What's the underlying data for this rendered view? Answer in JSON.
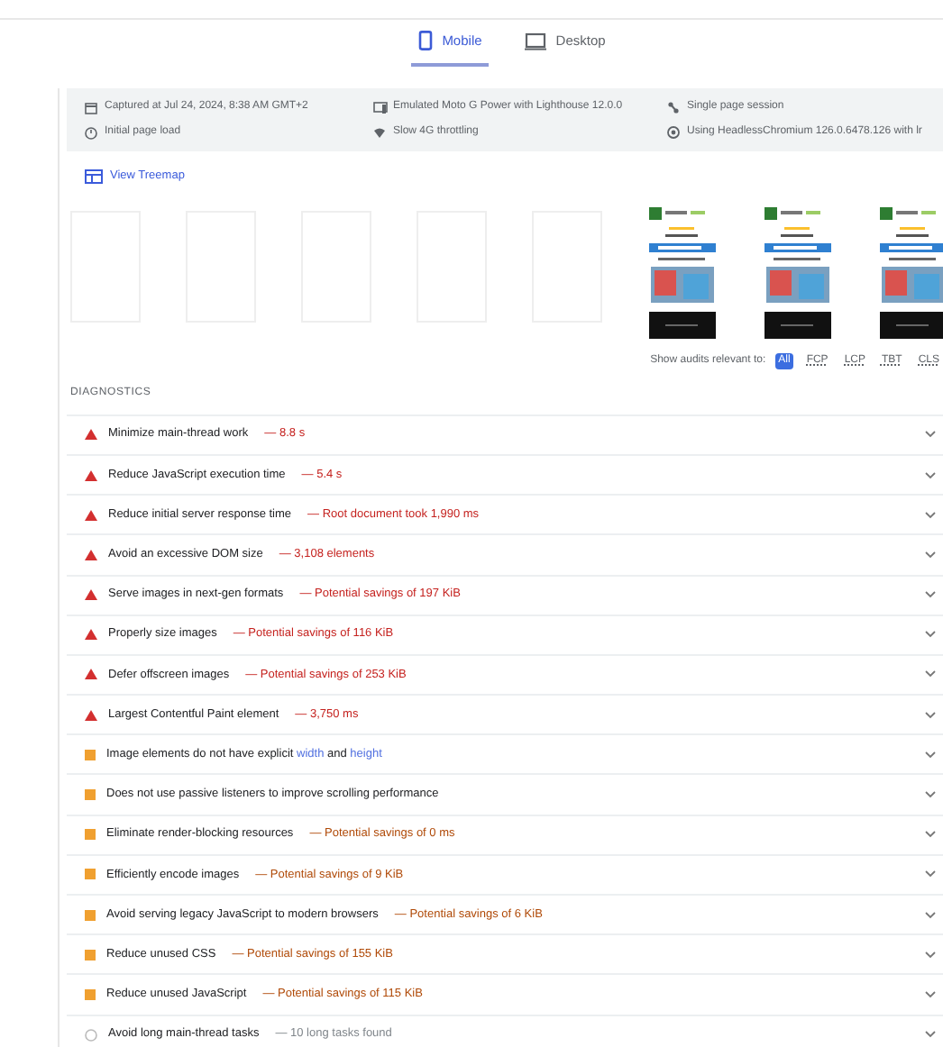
{
  "tabs": [
    {
      "label": "Mobile",
      "kind": "mobile",
      "selected": true
    },
    {
      "label": "Desktop",
      "kind": "desktop",
      "selected": false
    }
  ],
  "meta": [
    {
      "kind": "calendar",
      "text": "Captured at Jul 24, 2024, 8:38 AM GMT+2"
    },
    {
      "kind": "device",
      "text": "Emulated Moto G Power with Lighthouse 12.0.0"
    },
    {
      "kind": "session",
      "text": "Single page session"
    },
    {
      "kind": "timer",
      "text": "Initial page load"
    },
    {
      "kind": "network",
      "text": "Slow 4G throttling"
    },
    {
      "kind": "browser",
      "text": "Using HeadlessChromium 126.0.6478.126 with lr"
    }
  ],
  "treemap_link": "View Treemap",
  "filmstrip": [
    {
      "kind": "blank"
    },
    {
      "kind": "blank"
    },
    {
      "kind": "blank"
    },
    {
      "kind": "blank"
    },
    {
      "kind": "blank"
    },
    {
      "kind": "page"
    },
    {
      "kind": "page"
    },
    {
      "kind": "page"
    }
  ],
  "filter": {
    "label": "Show audits relevant to:",
    "options": [
      {
        "label": "All",
        "selected": true
      },
      {
        "label": "FCP",
        "selected": false
      },
      {
        "label": "LCP",
        "selected": false
      },
      {
        "label": "TBT",
        "selected": false
      },
      {
        "label": "CLS",
        "selected": false
      }
    ]
  },
  "section_title": "DIAGNOSTICS",
  "audits": [
    {
      "kind": "fail",
      "title": "Minimize main-thread work",
      "detail": "— 8.8 s"
    },
    {
      "kind": "fail",
      "title": "Reduce JavaScript execution time",
      "detail": "— 5.4 s"
    },
    {
      "kind": "fail",
      "title": "Reduce initial server response time",
      "detail": "— Root document took 1,990 ms"
    },
    {
      "kind": "fail",
      "title": "Avoid an excessive DOM size",
      "detail": "— 3,108 elements"
    },
    {
      "kind": "fail",
      "title": "Serve images in next-gen formats",
      "detail": "— Potential savings of 197 KiB"
    },
    {
      "kind": "fail",
      "title": "Properly size images",
      "detail": "— Potential savings of 116 KiB"
    },
    {
      "kind": "fail",
      "title": "Defer offscreen images",
      "detail": "— Potential savings of 253 KiB"
    },
    {
      "kind": "fail",
      "title": "Largest Contentful Paint element",
      "detail": "— 3,750 ms"
    },
    {
      "kind": "average",
      "title": [
        {
          "kind": "plain",
          "text": "Image elements do not have explicit "
        },
        {
          "kind": "code",
          "text": "width"
        },
        {
          "kind": "plain",
          "text": " and "
        },
        {
          "kind": "code",
          "text": "height"
        }
      ]
    },
    {
      "kind": "average",
      "title": "Does not use passive listeners to improve scrolling performance"
    },
    {
      "kind": "average",
      "title": "Eliminate render-blocking resources",
      "detail": "— Potential savings of 0 ms"
    },
    {
      "kind": "average",
      "title": "Efficiently encode images",
      "detail": "— Potential savings of 9 KiB"
    },
    {
      "kind": "average",
      "title": "Avoid serving legacy JavaScript to modern browsers",
      "detail": "— Potential savings of 6 KiB"
    },
    {
      "kind": "average",
      "title": "Reduce unused CSS",
      "detail": "— Potential savings of 155 KiB"
    },
    {
      "kind": "average",
      "title": "Reduce unused JavaScript",
      "detail": "— Potential savings of 115 KiB"
    },
    {
      "kind": "info",
      "title": "Avoid long main-thread tasks",
      "detail": "— 10 long tasks found"
    }
  ]
}
